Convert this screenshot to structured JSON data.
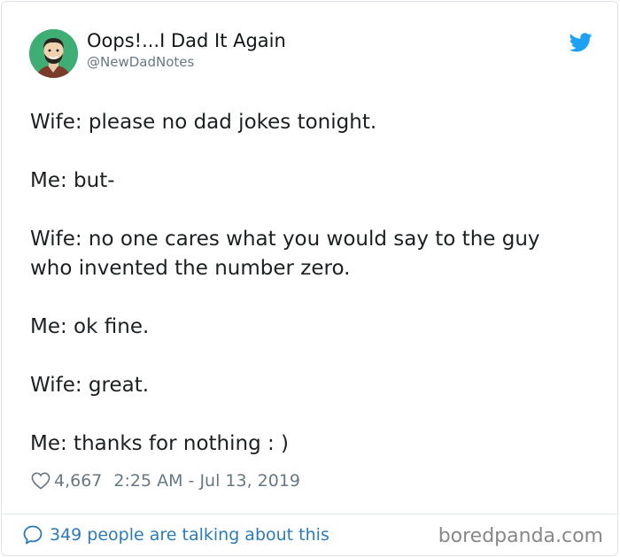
{
  "author": {
    "display_name": "Oops!...I Dad It Again",
    "handle": "@NewDadNotes",
    "avatar_icon": "cartoon-man-avatar"
  },
  "tweet": {
    "lines": [
      "Wife: please no dad jokes tonight.",
      "",
      "Me: but-",
      "",
      "Wife: no one cares what you would say to the guy",
      "who invented the number zero.",
      "",
      "Me: ok fine.",
      "",
      "Wife: great.",
      "",
      "Me: thanks for nothing : )"
    ]
  },
  "meta": {
    "likes": "4,667",
    "timestamp": "2:25 AM - Jul 13, 2019"
  },
  "footer": {
    "talking": "349 people are talking about this",
    "watermark": "boredpanda.com"
  },
  "colors": {
    "twitter_blue": "#1da1f2",
    "link_blue": "#2b7bb9",
    "muted": "#697882",
    "text": "#1c2022"
  },
  "icons": [
    "cartoon-man-avatar",
    "twitter-bird-icon",
    "heart-icon",
    "speech-bubble-icon"
  ]
}
